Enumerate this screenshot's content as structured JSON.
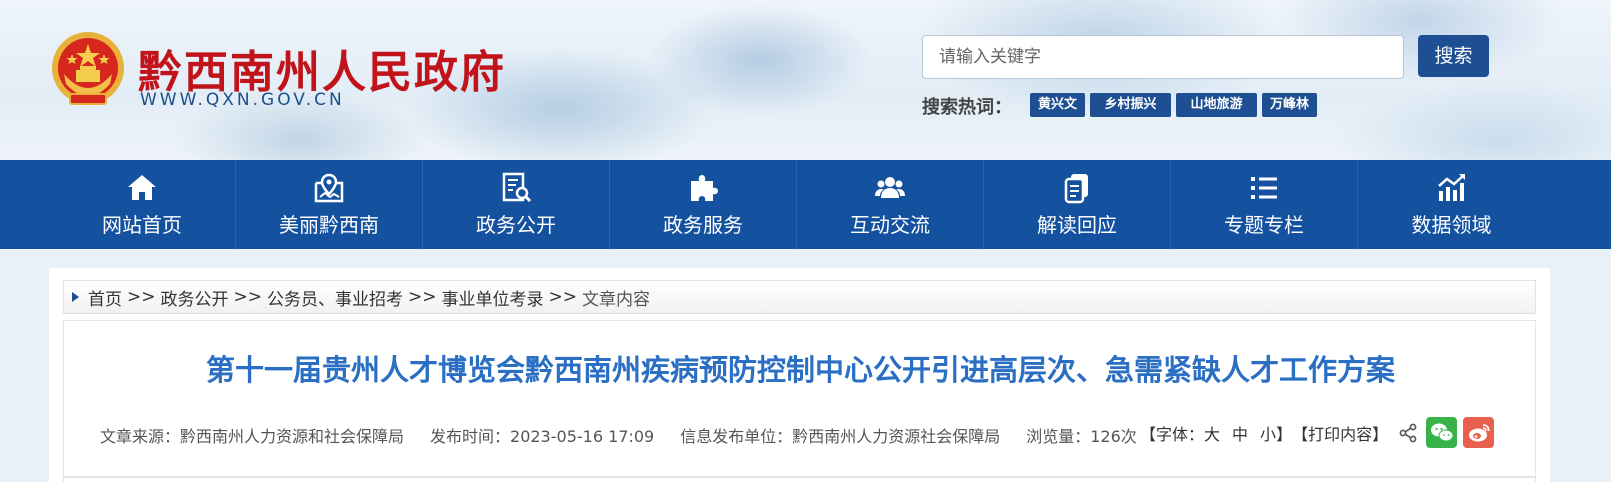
{
  "header": {
    "site_title": "黔西南州人民政府",
    "site_url": "WWW.QXN.GOV.CN",
    "search": {
      "placeholder": "请输入关键字",
      "button_label": "搜索"
    },
    "hot_label": "搜索热词：",
    "hot_tags": [
      "黄兴文",
      "乡村振兴",
      "山地旅游",
      "万峰林"
    ]
  },
  "nav": {
    "items": [
      {
        "label": "网站首页",
        "icon": "home-icon"
      },
      {
        "label": "美丽黔西南",
        "icon": "map-pin-icon"
      },
      {
        "label": "政务公开",
        "icon": "document-search-icon"
      },
      {
        "label": "政务服务",
        "icon": "puzzle-icon"
      },
      {
        "label": "互动交流",
        "icon": "people-icon"
      },
      {
        "label": "解读回应",
        "icon": "copy-document-icon"
      },
      {
        "label": "专题专栏",
        "icon": "list-icon"
      },
      {
        "label": "数据领域",
        "icon": "chart-trend-icon"
      }
    ]
  },
  "breadcrumb": {
    "items": [
      "首页",
      "政务公开",
      "公务员、事业招考",
      "事业单位考录",
      "文章内容"
    ],
    "separator": ">>"
  },
  "article": {
    "title": "第十一届贵州人才博览会黔西南州疾病预防控制中心公开引进高层次、急需紧缺人才工作方案",
    "source": "文章来源：黔西南州人力资源和社会保障局",
    "publish_time": "发布时间：2023-05-16 17:09",
    "publisher": "信息发布单位：黔西南州人力资源社会保障局",
    "views": "浏览量：126次"
  },
  "tools": {
    "font_prefix": "【字体：",
    "font_large": "大",
    "font_medium": "中",
    "font_small": "小",
    "font_suffix": "】",
    "print_label": "【打印内容】"
  },
  "colors": {
    "nav_bg": "#1452a0",
    "brand_red": "#c0141a",
    "title_blue": "#2a6fc3",
    "button_blue": "#1d4f92"
  }
}
